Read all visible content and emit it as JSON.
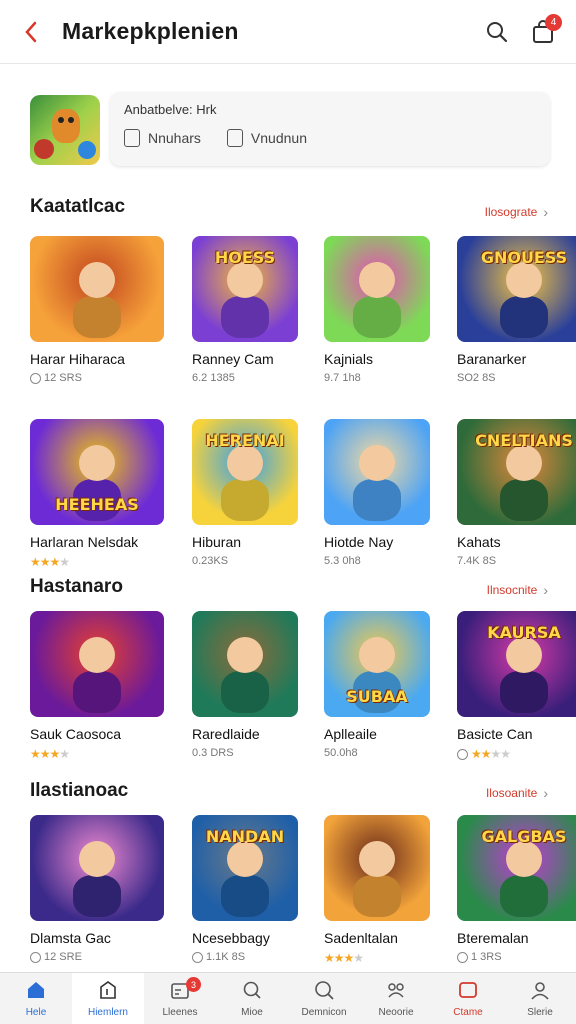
{
  "header": {
    "title": "Markepkplenien",
    "cart_badge": "4"
  },
  "featured": {
    "label": "Anbatbelve: Hrk",
    "option1": "Nnuhars",
    "option2": "Vnudnun"
  },
  "sections": [
    {
      "title": "Kaatatlcac",
      "see_all": "Ilosograte",
      "rows": [
        [
          {
            "name": "Harar Hiharaca",
            "meta": "12 SRS",
            "meta_type": "icon"
          },
          {
            "name": "Ranney Cam",
            "meta": "6.2 1385",
            "meta_type": "text"
          },
          {
            "name": "Kajnials",
            "meta": "9.7 1h8",
            "meta_type": "text"
          },
          {
            "name": "Baranarker",
            "meta": "SO2 8S",
            "meta_type": "text"
          }
        ],
        [
          {
            "name": "Harlaran Nelsdak",
            "meta": "",
            "meta_type": "stars",
            "rating": 3
          },
          {
            "name": "Hiburan",
            "meta": "0.23KS",
            "meta_type": "text"
          },
          {
            "name": "Hiotde Nay",
            "meta": "5.3 0h8",
            "meta_type": "text"
          },
          {
            "name": "Kahats",
            "meta": "7.4K 8S",
            "meta_type": "text"
          }
        ]
      ]
    },
    {
      "title": "Hastanaro",
      "see_all": "Ilnsocnite",
      "rows": [
        [
          {
            "name": "Sauk Caosoca",
            "meta": "",
            "meta_type": "stars",
            "rating": 3
          },
          {
            "name": "Raredlaide",
            "meta": "0.3 DRS",
            "meta_type": "text"
          },
          {
            "name": "Aplleaile",
            "meta": "50.0h8",
            "meta_type": "text"
          },
          {
            "name": "Basicte Can",
            "meta": "",
            "meta_type": "icon-stars",
            "rating": 2
          }
        ]
      ]
    },
    {
      "title": "Ilastianoac",
      "see_all": "Ilosoanite",
      "rows": [
        [
          {
            "name": "Dlamsta Gac",
            "meta": "12 SRE",
            "meta_type": "icon"
          },
          {
            "name": "Ncesebbagy",
            "meta": "1.1K 8S",
            "meta_type": "icon"
          },
          {
            "name": "Sadenltalan",
            "meta": "",
            "meta_type": "stars",
            "rating": 3
          },
          {
            "name": "Bteremalan",
            "meta": "1 3RS",
            "meta_type": "icon"
          }
        ]
      ]
    }
  ],
  "art_titles": [
    "",
    "HOESS",
    "",
    "GNOUESS",
    "HEEHEAS",
    "HERENAI",
    "",
    "CNELTIANS",
    "",
    "",
    "SUBAA",
    "KAURSA",
    "",
    "NANDAN",
    "",
    "GALGBAS"
  ],
  "nav": [
    {
      "label": "Hele",
      "icon": "home-icon"
    },
    {
      "label": "Hiemlern",
      "icon": "tag-icon"
    },
    {
      "label": "Lleenes",
      "icon": "calendar-icon",
      "badge": "3"
    },
    {
      "label": "Mioe",
      "icon": "chat-icon"
    },
    {
      "label": "Demnicon",
      "icon": "search-icon"
    },
    {
      "label": "Neoorie",
      "icon": "gamepad-icon"
    },
    {
      "label": "Ctame",
      "icon": "square-icon"
    },
    {
      "label": "Slerie",
      "icon": "profile-icon"
    }
  ],
  "colors": {
    "accent": "#d33a2c",
    "active": "#2b6fd6",
    "star": "#f5a623"
  }
}
